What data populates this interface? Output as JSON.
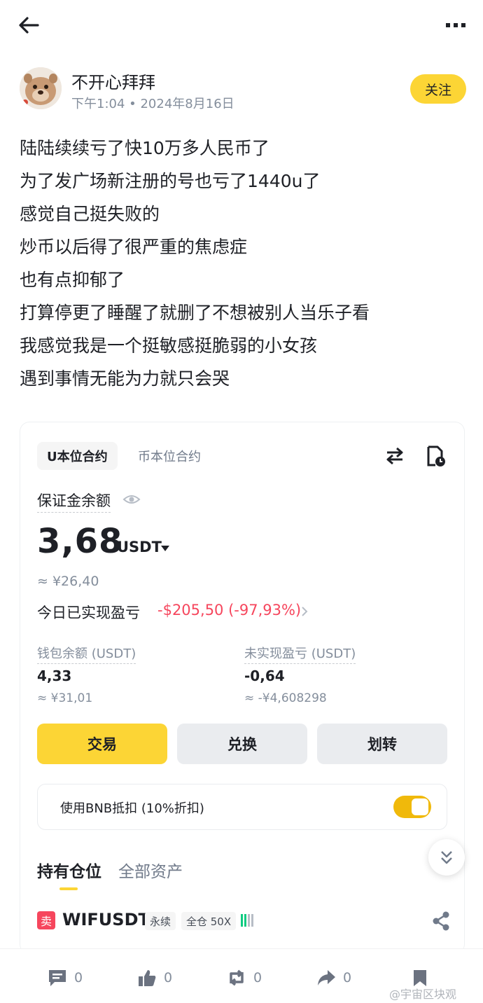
{
  "topbar": {
    "back_icon": "arrow-left-icon",
    "more_icon": "more-dots-icon"
  },
  "author": {
    "name": "不开心拜拜",
    "meta": "下午1:04 • 2024年8月16日",
    "follow_label": "关注"
  },
  "post": {
    "lines": [
      "陆陆续续亏了快10万多人民币了",
      "为了发广场新注册的号也亏了1440u了",
      "感觉自己挺失败的",
      "炒币以后得了很严重的焦虑症",
      "也有点抑郁了",
      "打算停更了睡醒了就删了不想被别人当乐子看",
      "我感觉我是一个挺敏感挺脆弱的小女孩",
      "遇到事情无能为力就只会哭"
    ]
  },
  "card": {
    "tab_active": "U本位合约",
    "tab_other": "币本位合约",
    "margin_label": "保证金余额",
    "balance": "3,68",
    "balance_unit": "USDT",
    "balance_approx": "≈ ¥26,40",
    "pnl_label": "今日已实现盈亏",
    "pnl_value": "-$205,50 (-97,93%)",
    "wallet_label": "钱包余额 (USDT)",
    "wallet_value": "4,33",
    "wallet_approx": "≈ ¥31,01",
    "unrealized_label": "未实现盈亏 (USDT)",
    "unrealized_value": "-0,64",
    "unrealized_approx": "≈ -¥4,608298",
    "btn_trade": "交易",
    "btn_convert": "兑换",
    "btn_transfer": "划转",
    "bnb_label": "使用BNB抵扣 (10%折扣)",
    "bnb_toggle_on": true,
    "pos_tab_active": "持有仓位",
    "pos_tab_other": "全部资产",
    "position": {
      "side": "卖",
      "symbol": "WIFUSDT",
      "tag_perp": "永续",
      "tag_cross": "全仓 50X"
    }
  },
  "actions": {
    "comment_count": "0",
    "like_count": "0",
    "repost_count": "0",
    "share_count": "0"
  },
  "watermark": "@宇宙区块观",
  "colors": {
    "accent_yellow": "#fcd535",
    "loss_red": "#f6465d",
    "muted_gray": "#848e9c"
  }
}
